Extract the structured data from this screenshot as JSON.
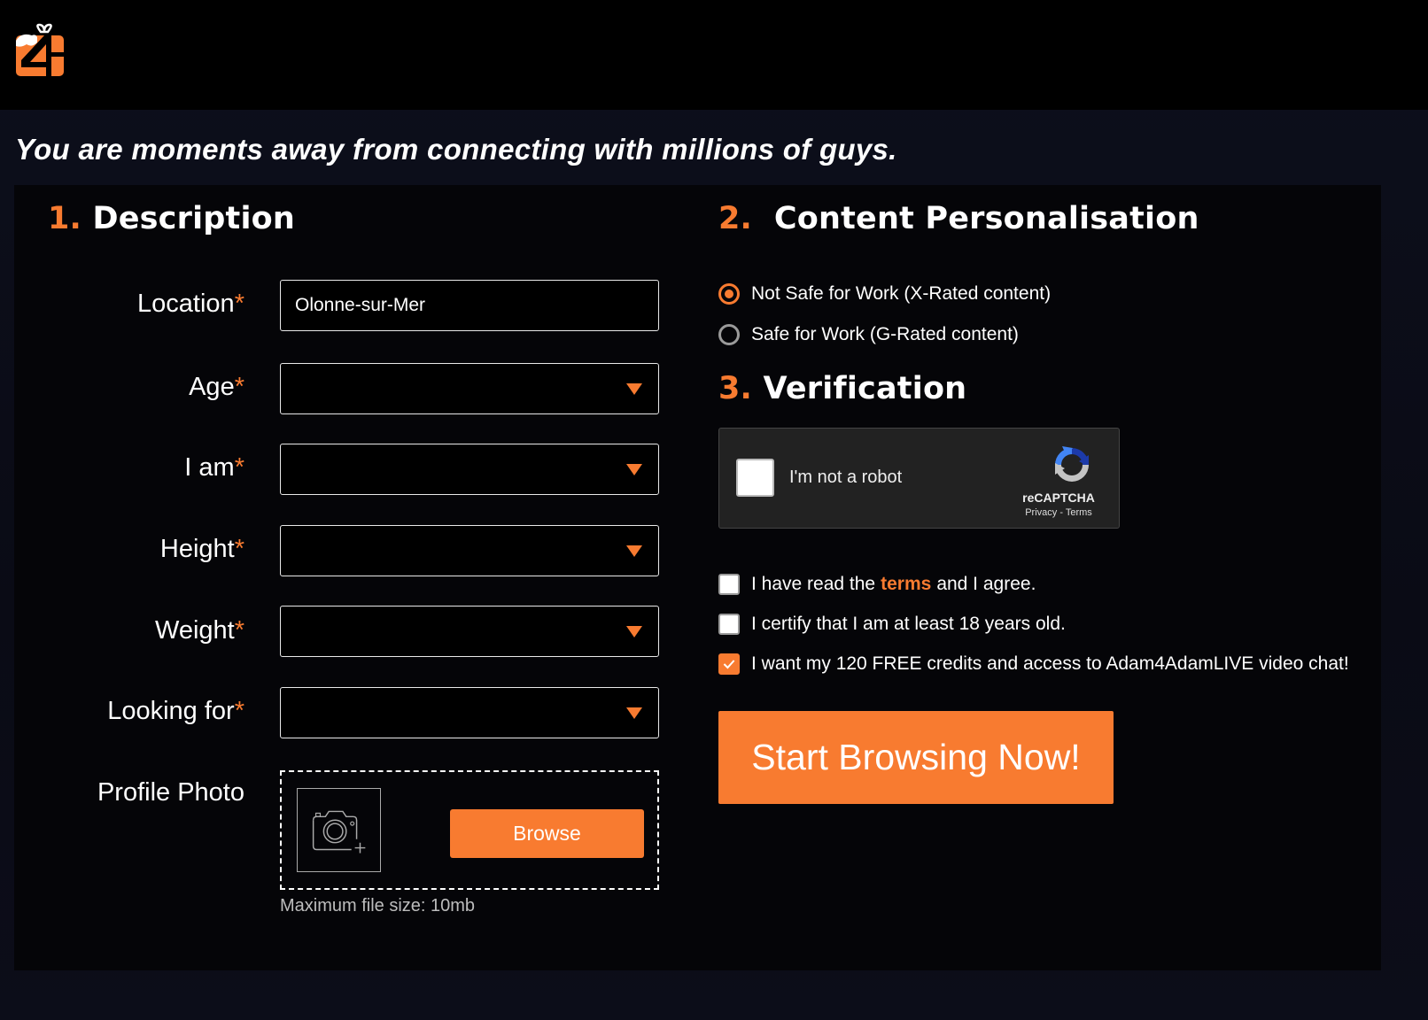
{
  "header": {
    "logo_alt": "Adam4Adam gift logo"
  },
  "tagline": "You are moments away from connecting with millions of guys.",
  "sections": {
    "description": {
      "num": "1.",
      "title": "Description"
    },
    "personalisation": {
      "num": "2.",
      "title": "Content Personalisation"
    },
    "verification": {
      "num": "3.",
      "title": "Verification"
    }
  },
  "form": {
    "required_marker": "*",
    "location": {
      "label": "Location",
      "value": "Olonne-sur-Mer"
    },
    "age": {
      "label": "Age",
      "value": ""
    },
    "i_am": {
      "label": "I am",
      "value": ""
    },
    "height": {
      "label": "Height",
      "value": ""
    },
    "weight": {
      "label": "Weight",
      "value": ""
    },
    "looking_for": {
      "label": "Looking for",
      "value": ""
    },
    "profile_photo": {
      "label": "Profile Photo",
      "browse_label": "Browse",
      "max_size_note": "Maximum file size: 10mb"
    }
  },
  "content_options": [
    {
      "label": "Not Safe for Work (X-Rated content)",
      "selected": true
    },
    {
      "label": "Safe for Work (G-Rated content)",
      "selected": false
    }
  ],
  "captcha": {
    "label": "I'm not a robot",
    "brand": "reCAPTCHA",
    "privacy": "Privacy",
    "separator": "-",
    "terms": "Terms",
    "checked": false
  },
  "agreements": {
    "terms": {
      "before": "I have read the",
      "link": "terms",
      "after": "and I agree.",
      "checked": false
    },
    "age": {
      "label": "I certify that I am at least 18 years old.",
      "checked": false
    },
    "credits": {
      "label": "I want my 120 FREE credits and access to Adam4AdamLIVE video chat!",
      "checked": true
    }
  },
  "submit_label": "Start Browsing Now!",
  "colors": {
    "accent": "#f87b30",
    "background": "#0b0c16",
    "panel": "#050508",
    "captcha_bg": "#222222"
  }
}
